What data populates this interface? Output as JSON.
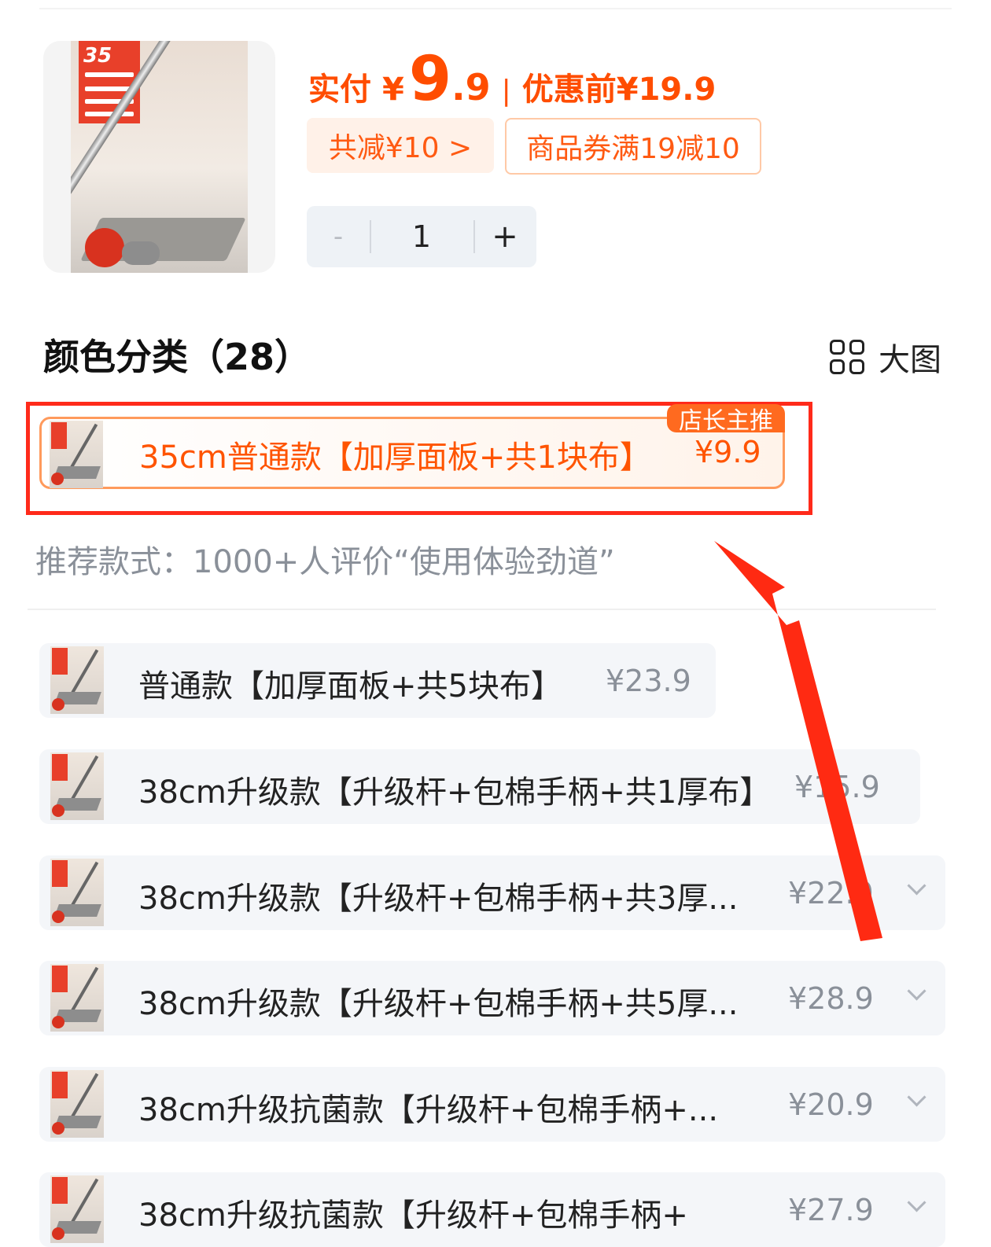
{
  "product": {
    "price_label": "实付",
    "currency": "¥",
    "price_int": "9",
    "price_dec": ".9",
    "separator": "|",
    "original_price": "优惠前¥19.9",
    "discount_chip": "共减¥10 >",
    "coupon_chip": "商品券满19减10"
  },
  "stepper": {
    "minus": "-",
    "quantity": "1",
    "plus": "+"
  },
  "section": {
    "title": "颜色分类（28）",
    "big_view": "大图"
  },
  "featured": {
    "tag": "店长主推",
    "name": "35cm普通款【加厚面板+共1块布】",
    "price": "¥9.9"
  },
  "recommendation": "推荐款式：1000+人评价“使用体验劲道”",
  "options": [
    {
      "name": "普通款【加厚面板+共5块布】",
      "price": "¥23.9"
    },
    {
      "name": "38cm升级款【升级杆+包棉手柄+共1厚布】",
      "price": "¥15.9"
    },
    {
      "name": "38cm升级款【升级杆+包棉手柄+共3厚...",
      "price": "¥22.9"
    },
    {
      "name": "38cm升级款【升级杆+包棉手柄+共5厚...",
      "price": "¥28.9"
    },
    {
      "name": "38cm升级抗菌款【升级杆+包棉手柄+...",
      "price": "¥20.9"
    },
    {
      "name": "38cm升级抗菌款【升级杆+包棉手柄+",
      "price": "¥27.9"
    }
  ],
  "colors": {
    "accent": "#ff4d00",
    "highlight": "#ff2a1a",
    "muted": "#8a9099"
  }
}
